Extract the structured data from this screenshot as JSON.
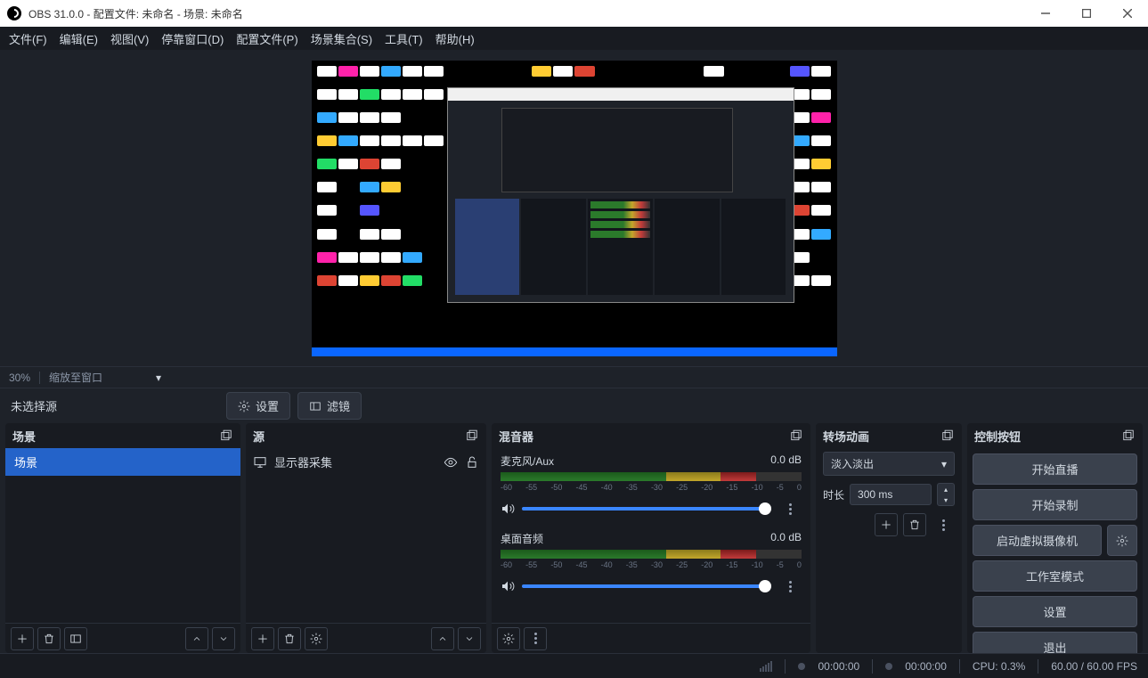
{
  "titlebar": {
    "title": "OBS 31.0.0 - 配置文件: 未命名 - 场景: 未命名"
  },
  "menu": [
    "文件(F)",
    "编辑(E)",
    "视图(V)",
    "停靠窗口(D)",
    "配置文件(P)",
    "场景集合(S)",
    "工具(T)",
    "帮助(H)"
  ],
  "zoom": {
    "pct": "30%",
    "label": "缩放至窗口"
  },
  "toolbar": {
    "no_source": "未选择源",
    "settings": "设置",
    "filters": "滤镜"
  },
  "panels": {
    "scenes": {
      "title": "场景",
      "items": [
        "场景"
      ]
    },
    "sources": {
      "title": "源",
      "items": [
        "显示器采集"
      ]
    },
    "mixer": {
      "title": "混音器",
      "channels": [
        {
          "name": "麦克风/Aux",
          "level": "0.0 dB"
        },
        {
          "name": "桌面音频",
          "level": "0.0 dB"
        }
      ],
      "ticks": [
        "-60",
        "-55",
        "-50",
        "-45",
        "-40",
        "-35",
        "-30",
        "-25",
        "-20",
        "-15",
        "-10",
        "-5",
        "0"
      ]
    },
    "transitions": {
      "title": "转场动画",
      "selected": "淡入淡出",
      "duration_label": "时长",
      "duration_value": "300 ms"
    },
    "controls": {
      "title": "控制按钮",
      "buttons": [
        "开始直播",
        "开始录制",
        "启动虚拟摄像机",
        "工作室模式",
        "设置",
        "退出"
      ]
    }
  },
  "status": {
    "stream_time": "00:00:00",
    "rec_time": "00:00:00",
    "cpu": "CPU: 0.3%",
    "fps": "60.00 / 60.00 FPS"
  }
}
